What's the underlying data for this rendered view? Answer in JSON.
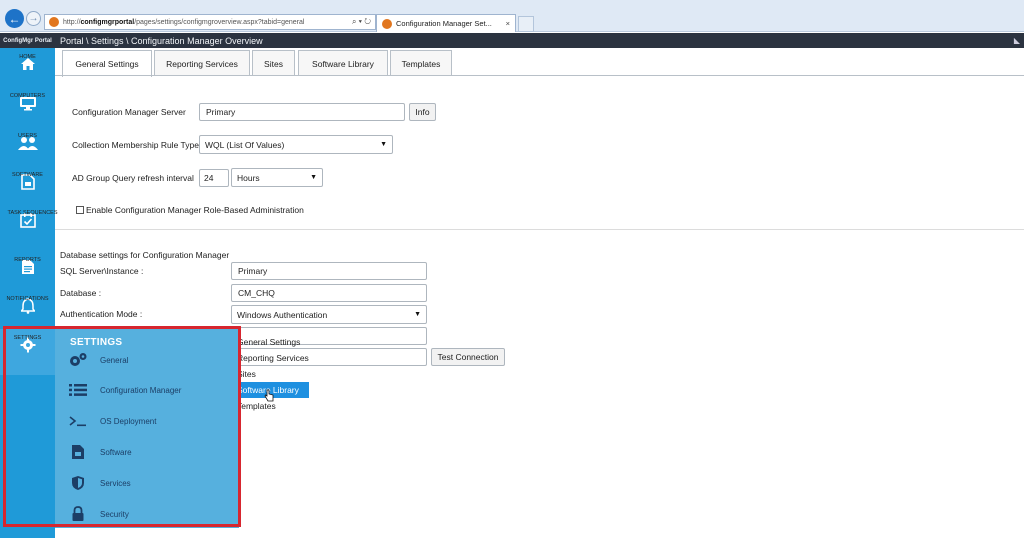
{
  "browser": {
    "url_prefix": "http://",
    "url_host": "configmgrportal",
    "url_path": "/pages/settings/configmgroverview.aspx?tabid=general",
    "url_controls": "⌕ ▾ ↻",
    "tab_title": "Configuration Manager Set...",
    "tab_close": "×"
  },
  "header": {
    "brand": "ConfigMgr Portal",
    "breadcrumb": "Portal \\ Settings \\ Configuration Manager Overview"
  },
  "nav": {
    "items": [
      {
        "label": "HOME",
        "icon": "home-icon"
      },
      {
        "label": "COMPUTERS",
        "icon": "monitor-icon"
      },
      {
        "label": "USERS",
        "icon": "users-icon"
      },
      {
        "label": "SOFTWARE",
        "icon": "software-icon"
      },
      {
        "label": "TASK SEQUENCES",
        "icon": "calendar-check-icon"
      },
      {
        "label": "REPORTS",
        "icon": "report-icon"
      },
      {
        "label": "NOTIFICATIONS",
        "icon": "bell-icon"
      },
      {
        "label": "SETTINGS",
        "icon": "gear-icon"
      }
    ]
  },
  "flyout": {
    "title": "SETTINGS",
    "items": [
      {
        "label": "General",
        "icon": "cogs-icon"
      },
      {
        "label": "Configuration Manager",
        "icon": "list-icon"
      },
      {
        "label": "OS Deployment",
        "icon": "terminal-icon"
      },
      {
        "label": "Software",
        "icon": "file-icon"
      },
      {
        "label": "Services",
        "icon": "shield-icon"
      },
      {
        "label": "Security",
        "icon": "lock-icon"
      }
    ]
  },
  "tabs": [
    "General Settings",
    "Reporting Services",
    "Sites",
    "Software Library",
    "Templates"
  ],
  "form": {
    "server_label": "Configuration Manager Server",
    "server_value": "Primary",
    "info_button": "Info",
    "collection_label": "Collection Membership Rule Type",
    "collection_value": "WQL (List Of Values)",
    "adgroup_label": "AD Group Query refresh interval",
    "adgroup_number": "24",
    "adgroup_unit": "Hours",
    "rbac_label": "Enable Configuration Manager Role-Based Administration",
    "rbac_checked": false
  },
  "database": {
    "heading": "Database settings for Configuration Manager",
    "sql_label": "SQL Server\\Instance :",
    "sql_value": "Primary",
    "db_label": "Database :",
    "db_value": "CM_CHQ",
    "auth_label": "Authentication Mode :",
    "auth_value": "Windows Authentication",
    "test_button": "Test Connection"
  },
  "dropdown": {
    "options": [
      "General Settings",
      "Reporting Services",
      "Sites",
      "Software Library",
      "Templates"
    ],
    "selected_index": 3
  }
}
